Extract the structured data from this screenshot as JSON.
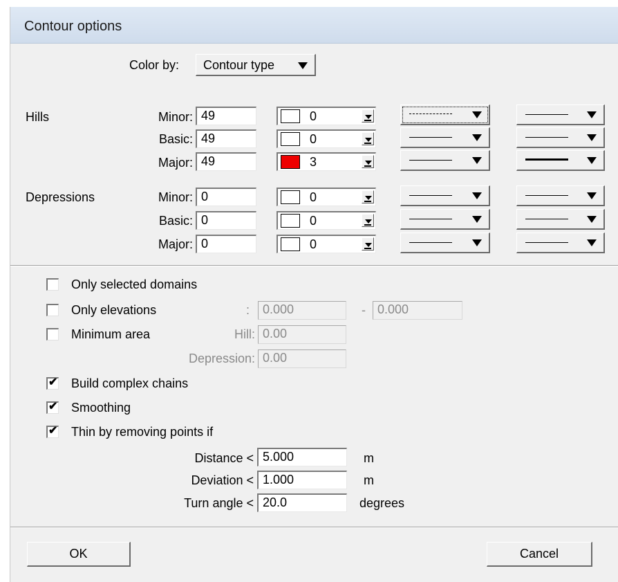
{
  "dialog": {
    "title": "Contour options"
  },
  "color_by": {
    "label": "Color by:",
    "value": "Contour type"
  },
  "sections": [
    {
      "name": "Hills",
      "rows": [
        {
          "label": "Minor:",
          "value": "49",
          "color": "white",
          "color_index": "0",
          "line_style": "dashed",
          "line_width": "thin"
        },
        {
          "label": "Basic:",
          "value": "49",
          "color": "white",
          "color_index": "0",
          "line_style": "solid",
          "line_width": "thin"
        },
        {
          "label": "Major:",
          "value": "49",
          "color": "red",
          "color_index": "3",
          "line_style": "solid",
          "line_width": "thick"
        }
      ]
    },
    {
      "name": "Depressions",
      "rows": [
        {
          "label": "Minor:",
          "value": "0",
          "color": "white",
          "color_index": "0",
          "line_style": "solid",
          "line_width": "thin"
        },
        {
          "label": "Basic:",
          "value": "0",
          "color": "white",
          "color_index": "0",
          "line_style": "solid",
          "line_width": "thin"
        },
        {
          "label": "Major:",
          "value": "0",
          "color": "white",
          "color_index": "0",
          "line_style": "solid",
          "line_width": "thin"
        }
      ]
    }
  ],
  "options": {
    "only_selected_domains": {
      "label": "Only selected domains",
      "checked": false
    },
    "only_elevations": {
      "label": "Only elevations",
      "checked": false,
      "colon": ":",
      "from": "0.000",
      "dash": "-",
      "to": "0.000"
    },
    "minimum_area": {
      "label": "Minimum area",
      "checked": false,
      "hill_label": "Hill:",
      "hill_value": "0.00",
      "depression_label": "Depression:",
      "depression_value": "0.00"
    },
    "build_complex_chains": {
      "label": "Build complex chains",
      "checked": true
    },
    "smoothing": {
      "label": "Smoothing",
      "checked": true
    },
    "thin": {
      "label": "Thin by removing points if",
      "checked": true
    }
  },
  "thin_params": [
    {
      "label": "Distance <",
      "value": "5.000",
      "unit": "m"
    },
    {
      "label": "Deviation <",
      "value": "1.000",
      "unit": "m"
    },
    {
      "label": "Turn angle <",
      "value": "20.0",
      "unit": "degrees"
    }
  ],
  "buttons": {
    "ok": "OK",
    "cancel": "Cancel"
  },
  "colors": {
    "red_swatch": "#ee0000",
    "dialog_bg": "#f0f0f0",
    "title_bg": "#d6e2f0"
  }
}
